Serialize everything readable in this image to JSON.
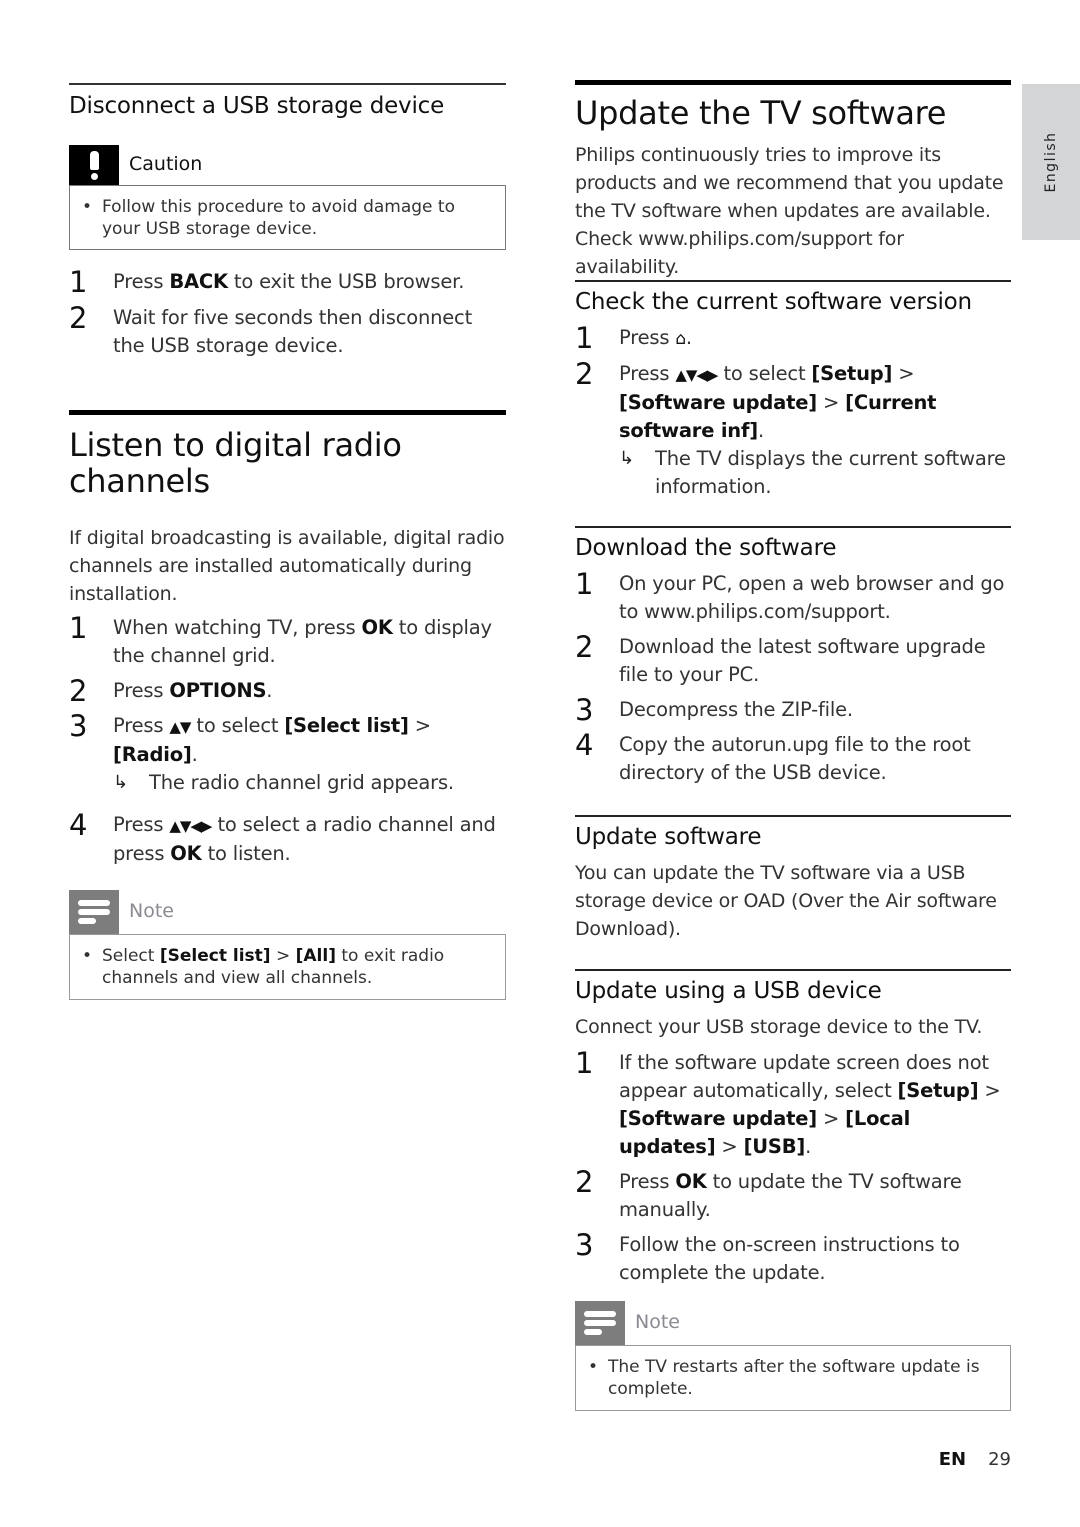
{
  "language_tab": "English",
  "footer": {
    "lang": "EN",
    "page": "29"
  },
  "left": {
    "disconnect": {
      "title": "Disconnect a USB storage device",
      "caution": {
        "label": "Caution",
        "items": [
          "Follow this procedure to avoid damage to your USB storage device."
        ]
      },
      "steps": [
        {
          "num": "1",
          "pre": "Press ",
          "bold": "BACK",
          "post": " to exit the USB browser."
        },
        {
          "num": "2",
          "text": "Wait for five seconds then disconnect the USB storage device."
        }
      ]
    },
    "radio": {
      "title": "Listen to digital radio channels",
      "intro": "If digital broadcasting is available, digital radio channels are installed automatically during installation.",
      "steps": [
        {
          "num": "1",
          "pre": "When watching TV, press ",
          "bold": "OK",
          "post": " to display the channel grid."
        },
        {
          "num": "2",
          "pre": "Press ",
          "bold": "OPTIONS",
          "post": "."
        },
        {
          "num": "3",
          "pre": "Press ",
          "arrows": "▲▼",
          "mid": " to select ",
          "b1": "[Select list]",
          "sep": " > ",
          "b2": "[Radio]",
          "post": ".",
          "result": "The radio channel grid appears."
        },
        {
          "num": "4",
          "pre": "Press ",
          "arrows": "▲▼◀▶",
          "mid": " to select a radio channel and press ",
          "bold": "OK",
          "post": " to listen."
        }
      ],
      "note": {
        "label": "Note",
        "pre": "Select ",
        "b1": "[Select list]",
        "sep": " > ",
        "b2": "[All]",
        "post": " to exit radio channels and view all channels."
      }
    }
  },
  "right": {
    "update": {
      "title": "Update the TV software",
      "intro": "Philips continuously tries to improve its products and we recommend that you update the TV software when updates are available. Check www.philips.com/support for availability."
    },
    "check": {
      "title": "Check the current software version",
      "step1": {
        "num": "1",
        "pre": "Press ",
        "icon": "⌂",
        "post": "."
      },
      "step2": {
        "num": "2",
        "pre": "Press ",
        "arrows": "▲▼◀▶",
        "mid": " to select ",
        "b1": "[Setup]",
        "sep1": " > ",
        "b2": "[Software update]",
        "sep2": " > ",
        "b3": "[Current software inf]",
        "post": ".",
        "result": "The TV displays the current software information."
      }
    },
    "download": {
      "title": "Download the software",
      "steps": [
        {
          "num": "1",
          "text": "On your PC, open a web browser and go to www.philips.com/support."
        },
        {
          "num": "2",
          "text": "Download the latest software upgrade file to your PC."
        },
        {
          "num": "3",
          "text": "Decompress the ZIP-file."
        },
        {
          "num": "4",
          "text": "Copy the autorun.upg file to the root directory of the USB device."
        }
      ]
    },
    "update_software": {
      "title": "Update software",
      "text": "You can update the TV software via a USB storage device or OAD (Over the Air software Download)."
    },
    "usb": {
      "title": "Update using a USB device",
      "intro": "Connect your USB storage device to the TV.",
      "step1": {
        "num": "1",
        "pre": "If the software update screen does not appear automatically, select ",
        "b1": "[Setup]",
        "sep1": " > ",
        "b2": "[Software update]",
        "sep2": " > ",
        "b3": "[Local updates]",
        "sep3": " > ",
        "b4": "[USB]",
        "post": "."
      },
      "step2": {
        "num": "2",
        "pre": "Press ",
        "bold": "OK",
        "post": " to update the TV software manually."
      },
      "step3": {
        "num": "3",
        "text": "Follow the on-screen instructions to complete the update."
      },
      "note": {
        "label": "Note",
        "items": [
          "The TV restarts after the software update is complete."
        ]
      }
    }
  }
}
